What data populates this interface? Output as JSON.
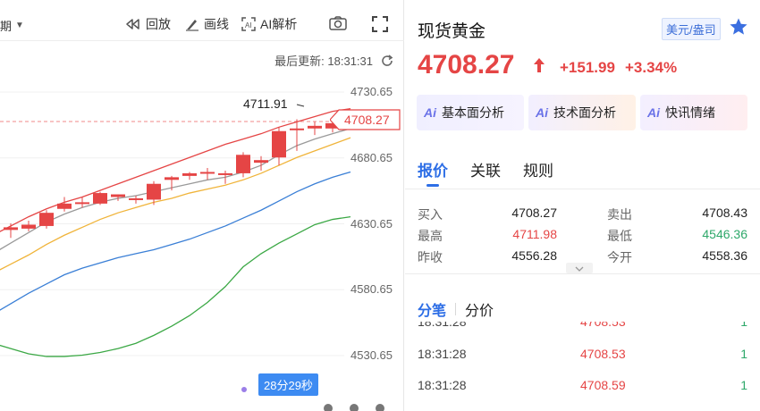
{
  "toolbar": {
    "period_label": "期",
    "replay_label": "回放",
    "draw_label": "画线",
    "ai_label": "AI解析"
  },
  "chart": {
    "last_update": "最后更新: 18:31:31",
    "y_axis": [
      "4730.65",
      "4680.65",
      "4630.65",
      "4580.65",
      "4530.65"
    ],
    "current_price_tag": "4708.27",
    "high_marker": "4711.91",
    "countdown": "28分29秒",
    "colors": {
      "up": "#e54545",
      "down": "#2cb56a",
      "ma1": "#9a9a9a",
      "ma2": "#f0b43a",
      "ma3": "#3a7fd6",
      "ma4": "#3ba845",
      "upper_band": "#e54545"
    }
  },
  "chart_data": {
    "type": "candlestick",
    "ylim": [
      4505,
      4740
    ],
    "candles": [
      {
        "o": 4626,
        "h": 4631,
        "l": 4620,
        "c": 4628
      },
      {
        "o": 4627,
        "h": 4633,
        "l": 4625,
        "c": 4630
      },
      {
        "o": 4629,
        "h": 4641,
        "l": 4627,
        "c": 4639
      },
      {
        "o": 4642,
        "h": 4651,
        "l": 4640,
        "c": 4646
      },
      {
        "o": 4646,
        "h": 4651,
        "l": 4643,
        "c": 4647
      },
      {
        "o": 4646,
        "h": 4655,
        "l": 4645,
        "c": 4654
      },
      {
        "o": 4651,
        "h": 4653,
        "l": 4648,
        "c": 4653
      },
      {
        "o": 4650,
        "h": 4652,
        "l": 4646,
        "c": 4650
      },
      {
        "o": 4649,
        "h": 4663,
        "l": 4645,
        "c": 4661
      },
      {
        "o": 4664,
        "h": 4667,
        "l": 4656,
        "c": 4666
      },
      {
        "o": 4667,
        "h": 4670,
        "l": 4664,
        "c": 4669
      },
      {
        "o": 4670,
        "h": 4673,
        "l": 4664,
        "c": 4670
      },
      {
        "o": 4669,
        "h": 4671,
        "l": 4661,
        "c": 4669
      },
      {
        "o": 4669,
        "h": 4685,
        "l": 4666,
        "c": 4683
      },
      {
        "o": 4677,
        "h": 4682,
        "l": 4671,
        "c": 4679
      },
      {
        "o": 4681,
        "h": 4704,
        "l": 4675,
        "c": 4701
      },
      {
        "o": 4703,
        "h": 4710,
        "l": 4686,
        "c": 4703
      },
      {
        "o": 4703,
        "h": 4708,
        "l": 4698,
        "c": 4705
      },
      {
        "o": 4703,
        "h": 4710,
        "l": 4700,
        "c": 4707
      },
      {
        "o": 4706,
        "h": 4712,
        "l": 4703,
        "c": 4710
      }
    ],
    "series": [
      {
        "values": [
          4629,
          4636,
          4642,
          4647,
          4651,
          4656,
          4661,
          4666,
          4671,
          4676,
          4681,
          4686,
          4691,
          4695,
          4699,
          4704,
          4708,
          4712,
          4716,
          4718
        ]
      },
      {
        "values": [
          4616,
          4624,
          4632,
          4638,
          4643,
          4647,
          4650,
          4652,
          4655,
          4658,
          4661,
          4664,
          4666,
          4670,
          4675,
          4683,
          4690,
          4695,
          4699,
          4703
        ]
      },
      {
        "values": [
          4600,
          4607,
          4615,
          4622,
          4628,
          4634,
          4639,
          4643,
          4647,
          4650,
          4654,
          4657,
          4660,
          4664,
          4669,
          4675,
          4681,
          4686,
          4691,
          4696
        ]
      },
      {
        "values": [
          4570,
          4578,
          4585,
          4592,
          4597,
          4601,
          4605,
          4608,
          4611,
          4615,
          4619,
          4624,
          4629,
          4635,
          4641,
          4648,
          4655,
          4661,
          4666,
          4670
        ]
      },
      {
        "values": [
          4584,
          4588,
          4592,
          4597,
          4601,
          4605,
          4608,
          4612,
          4615,
          4619,
          4624,
          4629,
          4635,
          4641,
          4647,
          4654,
          4660,
          4664,
          4667,
          4669
        ]
      },
      {
        "values": [
          4536,
          4532,
          4530,
          4530,
          4531,
          4533,
          4536,
          4540,
          4546,
          4553,
          4561,
          4571,
          4583,
          4598,
          4608,
          4616,
          4623,
          4630,
          4634,
          4636
        ]
      }
    ]
  },
  "instrument": {
    "name": "现货黄金",
    "unit": "美元/盎司",
    "price": "4708.27",
    "change": "+151.99",
    "change_pct": "+3.34%"
  },
  "ai_cards": [
    "基本面分析",
    "技术面分析",
    "快讯情绪"
  ],
  "tabs": [
    "报价",
    "关联",
    "规则"
  ],
  "stats": {
    "bid_label": "买入",
    "bid": "4708.27",
    "ask_label": "卖出",
    "ask": "4708.43",
    "high_label": "最高",
    "high": "4711.98",
    "low_label": "最低",
    "low": "4546.36",
    "prev_close_label": "昨收",
    "prev_close": "4556.28",
    "open_label": "今开",
    "open": "4558.36"
  },
  "subtabs": [
    "分笔",
    "分价"
  ],
  "trades": [
    {
      "time": "18:31:28",
      "price": "4708.53",
      "vol": "1"
    },
    {
      "time": "18:31:28",
      "price": "4708.59",
      "vol": "1"
    }
  ]
}
